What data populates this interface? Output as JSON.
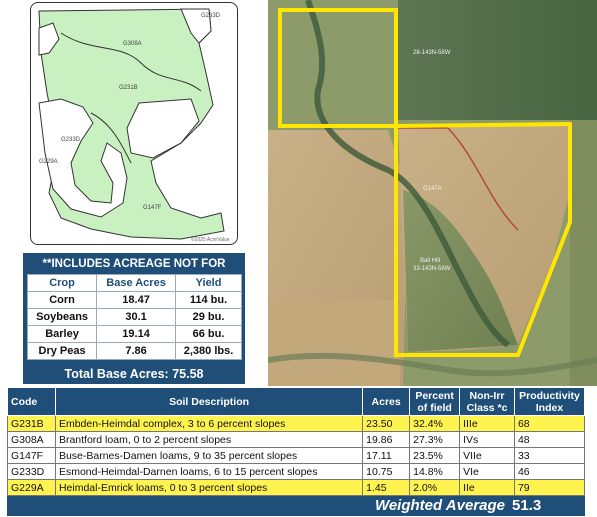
{
  "soil_map": {
    "units": [
      "G233D",
      "G308A",
      "G231B",
      "G233D",
      "G229A",
      "G147F"
    ],
    "copyright": "©2025 AcreValue"
  },
  "aerial": {
    "labels": [
      "28-143N-58W",
      "G147A",
      "Ball Hill",
      "33-143N-58W"
    ]
  },
  "crop_table": {
    "note": "**INCLUDES ACREAGE NOT FOR SALE**",
    "headers": [
      "Crop",
      "Base Acres",
      "Yield"
    ],
    "rows": [
      [
        "Corn",
        "18.47",
        "114 bu."
      ],
      [
        "Soybeans",
        "30.1",
        "29 bu."
      ],
      [
        "Barley",
        "19.14",
        "66 bu."
      ],
      [
        "Dry Peas",
        "7.86",
        "2,380 lbs."
      ]
    ],
    "total": "Total Base Acres: 75.58"
  },
  "soil_table": {
    "headers": {
      "code": "Code",
      "desc": "Soil Description",
      "acres": "Acres",
      "pct_1": "Percent",
      "pct_2": "of field",
      "class_1": "Non-Irr",
      "class_2": "Class *c",
      "pi_1": "Productivity",
      "pi_2": "Index"
    },
    "rows": [
      {
        "code": "G231B",
        "desc": "Embden-Heimdal complex, 3 to 6 percent slopes",
        "acres": "23.50",
        "pct": "32.4%",
        "class": "IIIe",
        "pi": "68"
      },
      {
        "code": "G308A",
        "desc": "Brantford loam, 0 to 2 percent slopes",
        "acres": "19.86",
        "pct": "27.3%",
        "class": "IVs",
        "pi": "48"
      },
      {
        "code": "G147F",
        "desc": "Buse-Barnes-Damen loams, 9 to 35 percent slopes",
        "acres": "17.11",
        "pct": "23.5%",
        "class": "VIIe",
        "pi": "33"
      },
      {
        "code": "G233D",
        "desc": "Esmond-Heimdal-Darnen loams, 6 to 15 percent slopes",
        "acres": "10.75",
        "pct": "14.8%",
        "class": "VIe",
        "pi": "46"
      },
      {
        "code": "G229A",
        "desc": "Heimdal-Emrick loams, 0 to 3 percent slopes",
        "acres": "1.45",
        "pct": "2.0%",
        "class": "IIe",
        "pi": "79"
      }
    ],
    "weighted_label": "Weighted Average",
    "weighted_value": "51.3"
  },
  "colors": {
    "navy": "#1f4e79",
    "highlight": "#fff44f",
    "soil_fill": "#c8f0c0",
    "boundary": "#ffe600"
  }
}
